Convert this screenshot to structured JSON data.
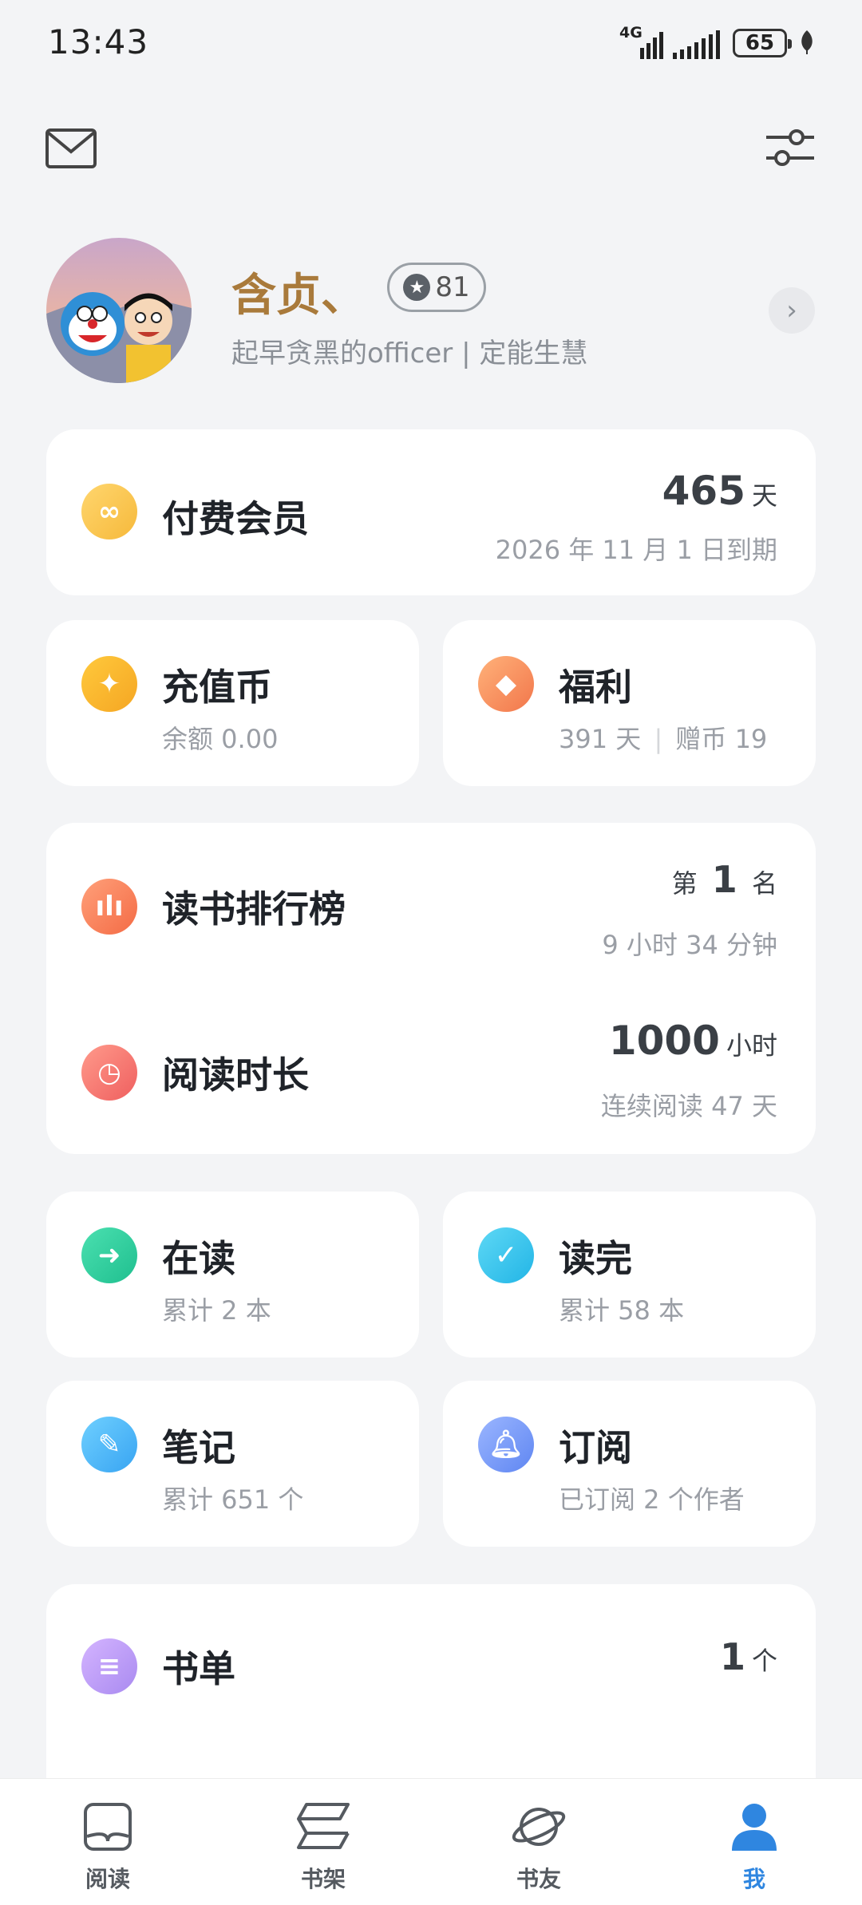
{
  "status_bar": {
    "time": "13:43",
    "network": "4G",
    "battery": "65"
  },
  "profile": {
    "nickname": "含贞、",
    "level": "81",
    "signature": "起早贪黑的officer | 定能生慧"
  },
  "membership": {
    "title": "付费会员",
    "days_value": "465",
    "days_unit": "天",
    "expiry": "2026 年 11 月 1 日到期"
  },
  "coins": {
    "title": "充值币",
    "subtitle": "余额 0.00"
  },
  "welfare": {
    "title": "福利",
    "days": "391 天",
    "gift": "赠币 19"
  },
  "ranking": {
    "title": "读书排行榜",
    "rank_prefix": "第",
    "rank_value": "1",
    "rank_suffix": "名",
    "time": "9 小时 34 分钟"
  },
  "reading_time": {
    "title": "阅读时长",
    "hours": "1000",
    "unit": "小时",
    "streak": "连续阅读 47 天"
  },
  "reading": {
    "title": "在读",
    "subtitle": "累计 2 本"
  },
  "finished": {
    "title": "读完",
    "subtitle": "累计 58 本"
  },
  "notes": {
    "title": "笔记",
    "subtitle": "累计 651 个"
  },
  "subscription": {
    "title": "订阅",
    "subtitle": "已订阅 2 个作者"
  },
  "booklist": {
    "title": "书单",
    "count": "1",
    "unit": "个"
  },
  "bottom_nav": {
    "items": [
      {
        "label": "阅读",
        "icon": "book-open-icon"
      },
      {
        "label": "书架",
        "icon": "bookshelf-icon"
      },
      {
        "label": "书友",
        "icon": "planet-icon"
      },
      {
        "label": "我",
        "icon": "person-icon"
      }
    ],
    "active": "我"
  },
  "colors": {
    "background": "#f3f4f6",
    "nickname": "#a97a3b",
    "nav_active": "#2f86e0"
  }
}
